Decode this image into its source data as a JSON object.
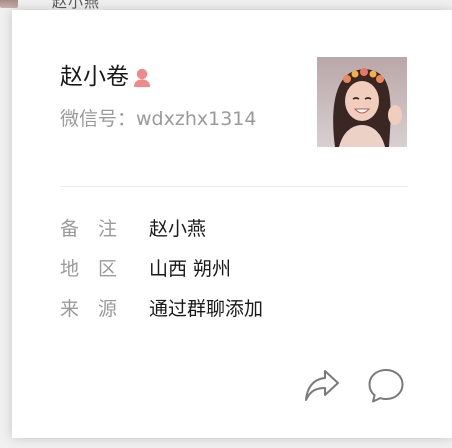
{
  "background": {
    "top_text": "赵小燕",
    "bottom_text": "...."
  },
  "profile": {
    "nickname": "赵小卷",
    "gender": "female",
    "gender_color": "#f08a87",
    "wechat_id_label": "微信号：",
    "wechat_id": "wdxzhx1314"
  },
  "details": [
    {
      "label": "备　注",
      "value": "赵小燕"
    },
    {
      "label": "地　区",
      "value": "山西 朔州"
    },
    {
      "label": "来　源",
      "value": "通过群聊添加"
    }
  ],
  "actions": {
    "share_icon": "share-icon",
    "message_icon": "message-icon",
    "icon_color": "#7a7a7a"
  }
}
